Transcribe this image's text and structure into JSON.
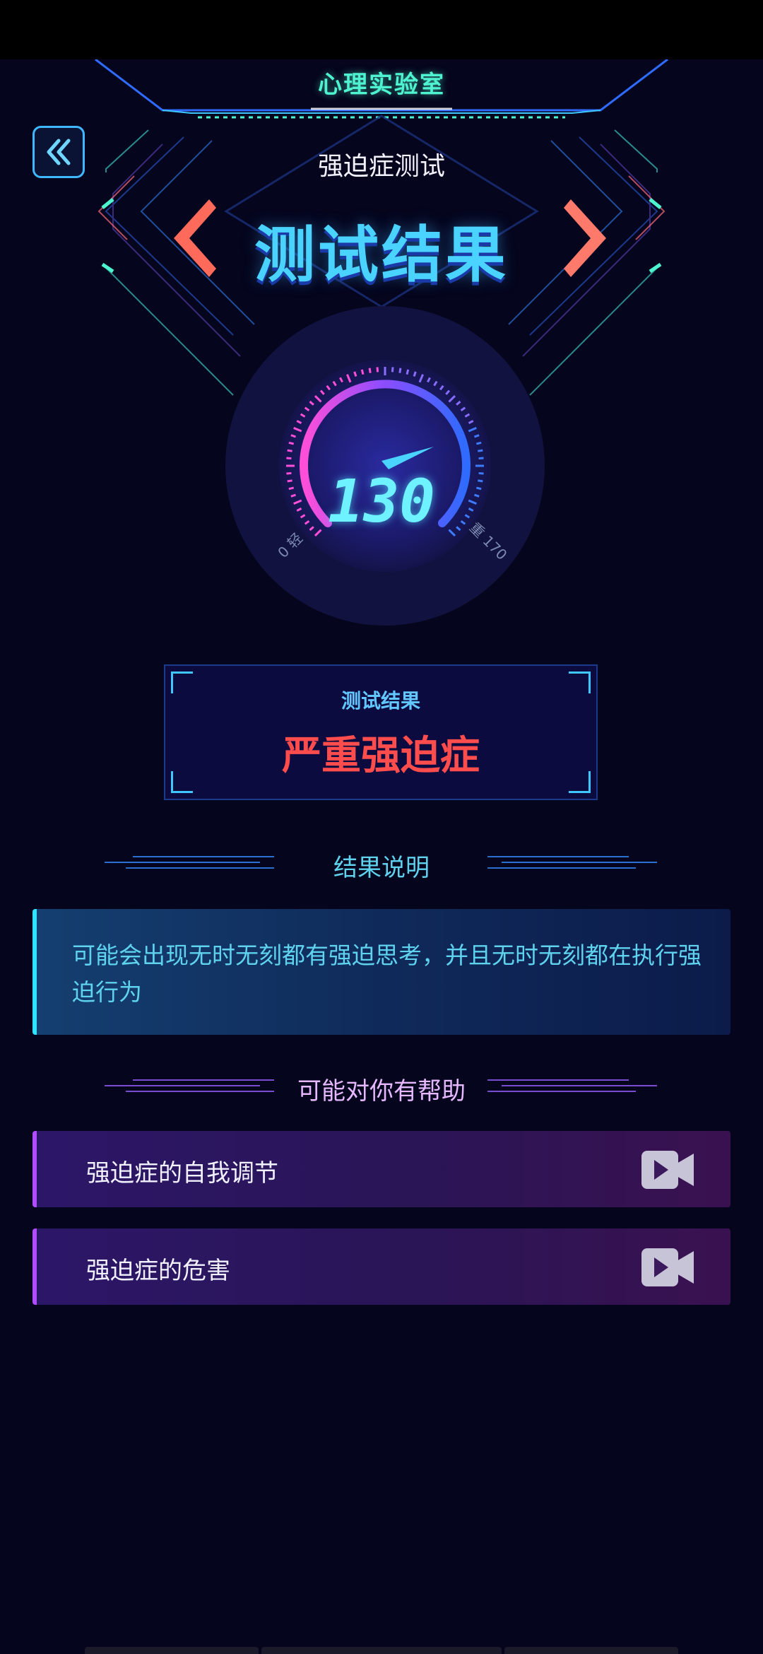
{
  "header": {
    "app_title": "心理实验室",
    "back_icon": "double-chevron-left-icon",
    "test_name": "强迫症测试",
    "result_title": "测试结果"
  },
  "gauge": {
    "score": "130",
    "min_label": "0 轻",
    "max_label": "重 170",
    "min": 0,
    "max": 170,
    "value": 130
  },
  "result_box": {
    "label": "测试结果",
    "value": "严重强迫症"
  },
  "explanation": {
    "heading": "结果说明",
    "text": "可能会出现无时无刻都有强迫思考，并且无时无刻都在执行强迫行为"
  },
  "help": {
    "heading": "可能对你有帮助",
    "items": [
      {
        "label": "强迫症的自我调节",
        "icon": "video-icon"
      },
      {
        "label": "强迫症的危害",
        "icon": "video-icon"
      }
    ]
  },
  "colors": {
    "background": "#05051d",
    "accent_cyan": "#4ad3ff",
    "danger": "#ff4d4d",
    "help_accent": "#b04dff"
  }
}
